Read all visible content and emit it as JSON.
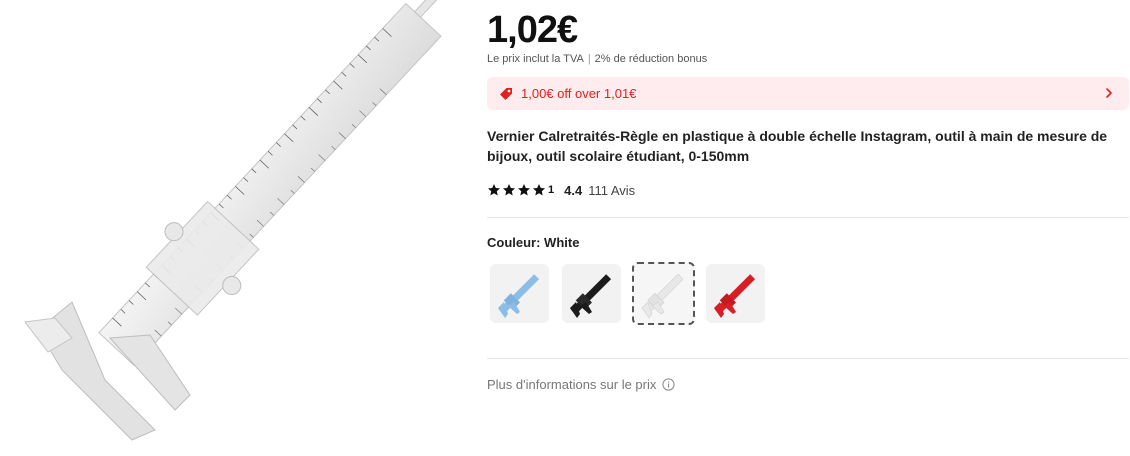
{
  "product": {
    "price": "1,02€",
    "tax_note": "Le prix inclut la TVA",
    "bonus_note": "2% de réduction bonus",
    "promo_text": "1,00€ off over 1,01€",
    "title": "Vernier Calretraités-Règle en plastique à double échelle Instagram, outil à main de mesure de bijoux, outil scolaire étudiant, 0-150mm",
    "rating_stars": 4.4,
    "rating_fraction_label": "1",
    "rating_value": "4.4",
    "reviews_label": "111 Avis",
    "color_label": "Couleur: White",
    "more_info_label": "Plus d'informations sur le prix",
    "swatches": [
      {
        "name": "Blue",
        "color": "#8cbde6",
        "selected": false
      },
      {
        "name": "Black",
        "color": "#1c1c1c",
        "selected": false
      },
      {
        "name": "White",
        "color": "#e8e8e8",
        "selected": true
      },
      {
        "name": "Red",
        "color": "#d81f26",
        "selected": false
      }
    ]
  },
  "icons": {
    "promo": "price-tag-icon",
    "promo_arrow": "chevron-right-icon",
    "star": "star-icon",
    "info": "info-circle-icon"
  },
  "colors": {
    "promo_bg": "#ffecee",
    "promo_text": "#e02020",
    "accent_red": "#e02020"
  }
}
